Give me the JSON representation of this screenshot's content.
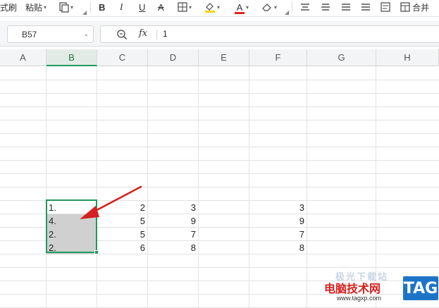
{
  "toolbar": {
    "format_painter_label": "式刷",
    "paste_label": "粘贴",
    "bold_label": "B",
    "italic_label": "I",
    "underline_label": "U",
    "strike_label": "A",
    "font_color_letter": "A",
    "merge_label": "合并",
    "accent_yellow": "#f5d200",
    "accent_red": "#e02020"
  },
  "formula_bar": {
    "name_box": "B57",
    "fx_label": "fx",
    "value": "1"
  },
  "columns": [
    "A",
    "B",
    "C",
    "D",
    "E",
    "F",
    "G",
    "H"
  ],
  "active_column": "B",
  "cells": {
    "b1": "1.",
    "b2": "4.",
    "b3": "2.",
    "b4": "2.",
    "c1": "2",
    "c2": "5",
    "c3": "5",
    "c4": "6",
    "d1": "3",
    "d2": "9",
    "d3": "7",
    "d4": "8",
    "f1": "3",
    "f2": "9",
    "f3": "7",
    "f4": "8"
  },
  "watermark": {
    "site_name": "电脑技术网",
    "tag": "TAG",
    "url": "www.tagxp.com",
    "faint_text": "极光下载站"
  },
  "colors": {
    "selection_green": "#1f9a5b",
    "selected_fill": "#d0d0d0",
    "arrow_red": "#d42020"
  }
}
